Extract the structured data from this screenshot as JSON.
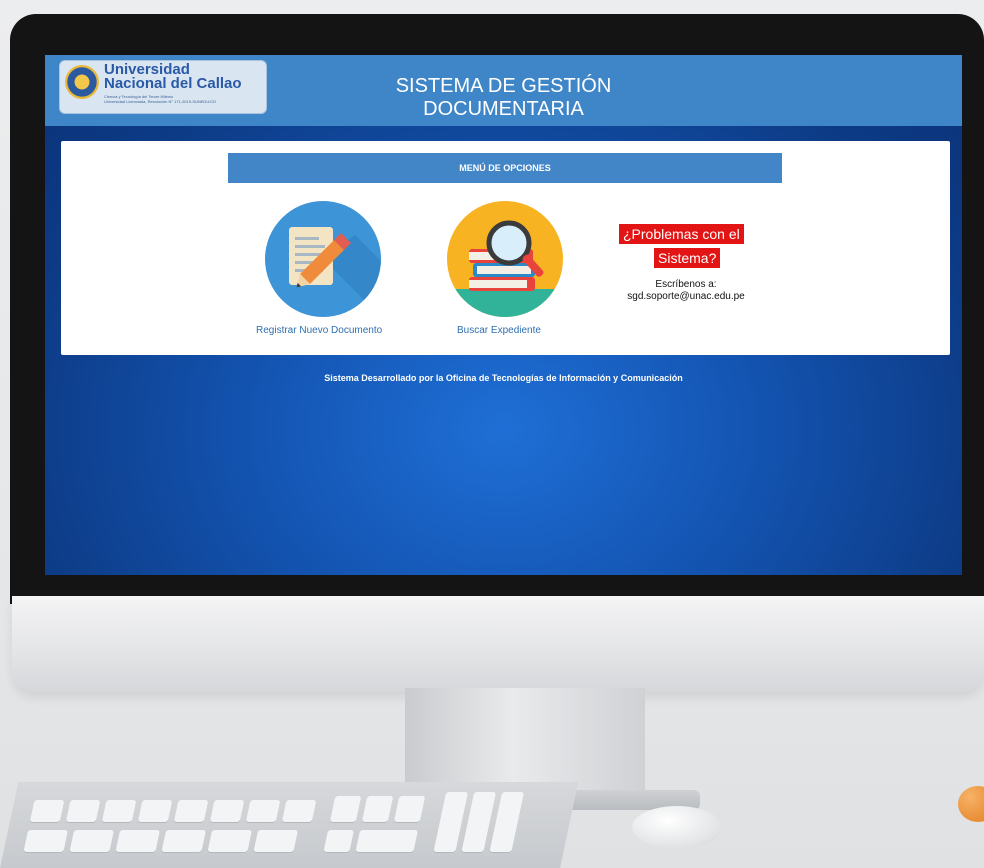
{
  "header": {
    "logo_line1": "Universidad",
    "logo_line2": "Nacional del Callao",
    "logo_line3": "Ciencia y Tecnología del Tercer Milenio",
    "logo_line4": "Universidad Licenciada, Resolución N° 171-2019-SUNEDU/CD",
    "title_line1": "SISTEMA DE GESTIÓN",
    "title_line2": "DOCUMENTARIA"
  },
  "menu": {
    "title": "MENÚ DE OPCIONES",
    "options": [
      {
        "label": "Registrar Nuevo Documento",
        "icon": "document-pencil-icon"
      },
      {
        "label": "Buscar Expediente",
        "icon": "books-magnifier-icon"
      }
    ]
  },
  "support": {
    "line1": "¿Problemas con el",
    "line2": "Sistema?",
    "write_to": "Escríbenos a:",
    "email": "sgd.soporte@unac.edu.pe"
  },
  "footer": {
    "text": "Sistema Desarrollado por la Oficina de Tecnologías de Información y Comunicación"
  },
  "colors": {
    "header_blue": "#3f86c8",
    "menu_bar": "#4286c8",
    "alert_red": "#e31414",
    "screen_blue": "#1353b0"
  }
}
